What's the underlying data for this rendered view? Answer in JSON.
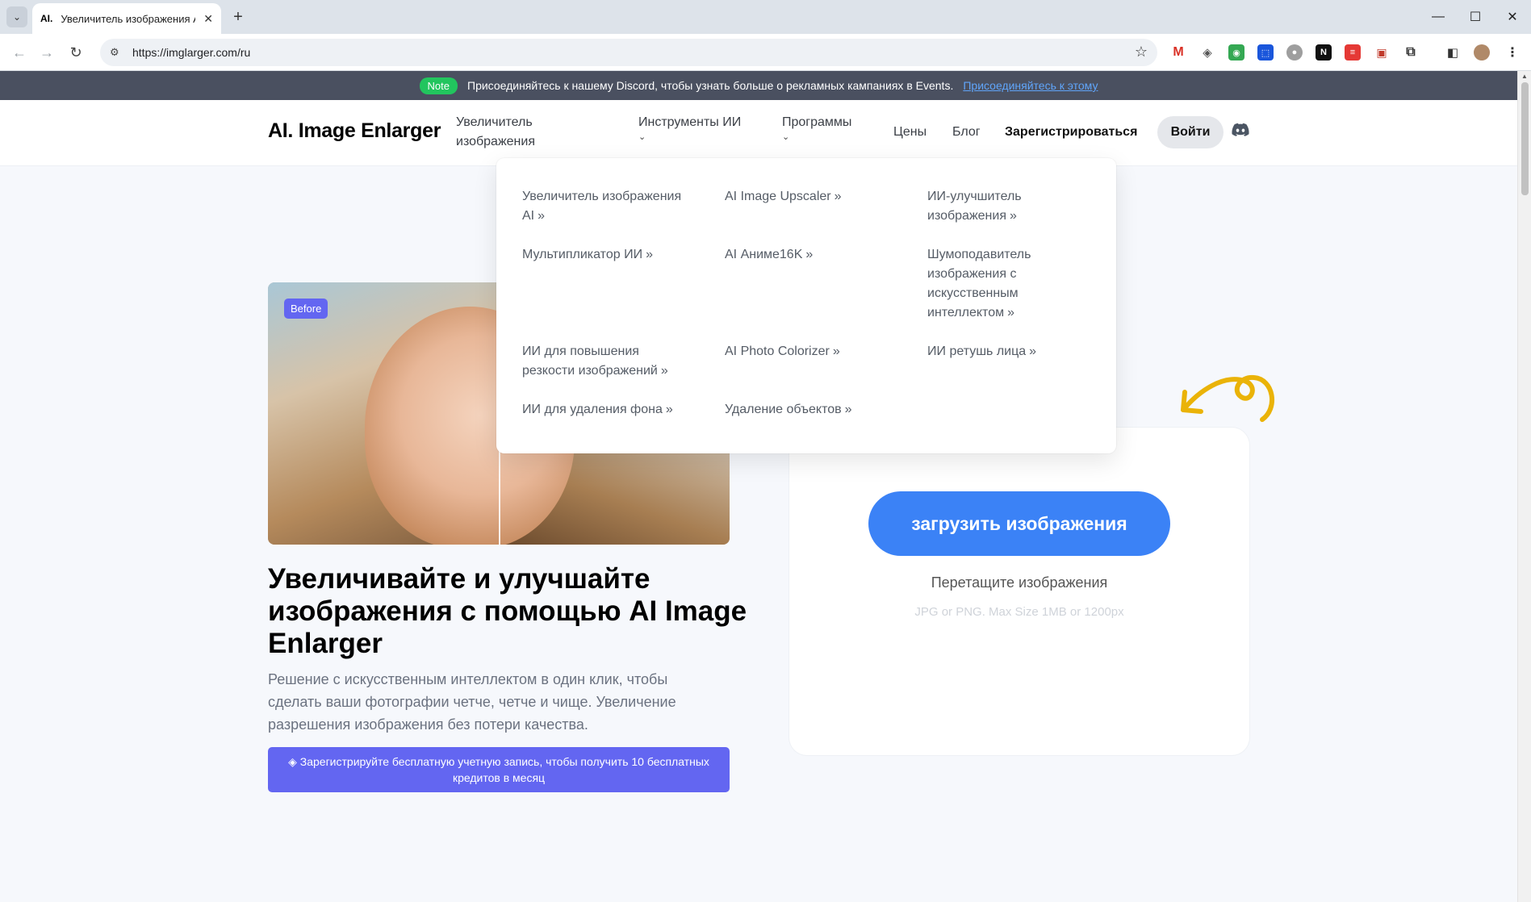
{
  "browser": {
    "tab_favicon": "AI.",
    "tab_title": "Увеличитель изображения AI",
    "url": "https://imglarger.com/ru"
  },
  "announcement": {
    "badge": "Note",
    "text": "Присоединяйтесь к нашему Discord, чтобы узнать больше о рекламных кампаниях в Events.",
    "link": "Присоединяйтесь к этому"
  },
  "nav": {
    "logo": "AI. Image Enlarger",
    "items": [
      {
        "label": "Увеличитель изображения"
      },
      {
        "label": "Инструменты ИИ"
      },
      {
        "label": "Программы"
      },
      {
        "label": "Цены"
      },
      {
        "label": "Блог"
      }
    ],
    "signup": "Зарегистрироваться",
    "login": "Войти"
  },
  "dropdown": {
    "items": [
      "Увеличитель изображения AI",
      "AI Image Upscaler",
      "ИИ-улучшитель изображения",
      "Мультипликатор ИИ",
      "AI Аниме16K",
      "Шумоподавитель изображения с искусственным интеллектом",
      "ИИ для повышения резкости изображений",
      "AI Photo Colorizer",
      "ИИ ретушь лица",
      "ИИ для удаления фона",
      "Удаление объектов"
    ]
  },
  "hero": {
    "before_badge": "Before",
    "title": "Увеличивайте и улучшайте изображения с помощью AI Image Enlarger",
    "description": "Решение с искусственным интеллектом в один клик, чтобы сделать ваши фотографии четче, четче и чище. Увеличение разрешения изображения без потери качества.",
    "cta": "Зарегистрируйте бесплатную учетную запись, чтобы получить 10 бесплатных кредитов в месяц"
  },
  "upload": {
    "button": "загрузить изображения",
    "drop_text": "Перетащите изображения",
    "hint": "JPG or PNG. Max Size 1MB or 1200px"
  },
  "colors": {
    "accent_blue": "#3b82f6",
    "indigo": "#6366f1",
    "note_green": "#22c55e",
    "doodle": "#eab308"
  }
}
